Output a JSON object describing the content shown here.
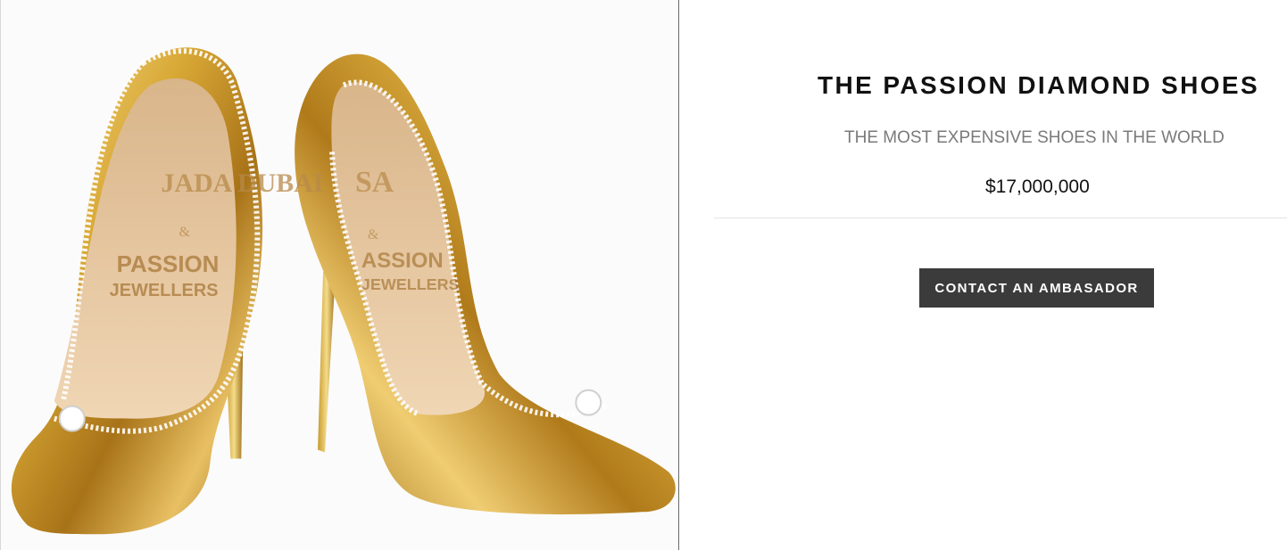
{
  "product": {
    "title": "THE PASSION DIAMOND SHOES",
    "subtitle": "THE MOST EXPENSIVE SHOES IN THE WORLD",
    "price": "$17,000,000",
    "cta_label": "CONTACT AN AMBASADOR"
  },
  "image": {
    "insole_brand_top": "JADA DUBAI",
    "insole_connector": "&",
    "insole_brand_bottom": "PASSION JEWELLERS"
  },
  "colors": {
    "gold_light": "#f3d98a",
    "gold_mid": "#d6a531",
    "gold_dark": "#9a6a12",
    "insole": "#e8c8a2",
    "button_bg": "#3b3b3b",
    "subtitle_text": "#7a7a7a"
  }
}
